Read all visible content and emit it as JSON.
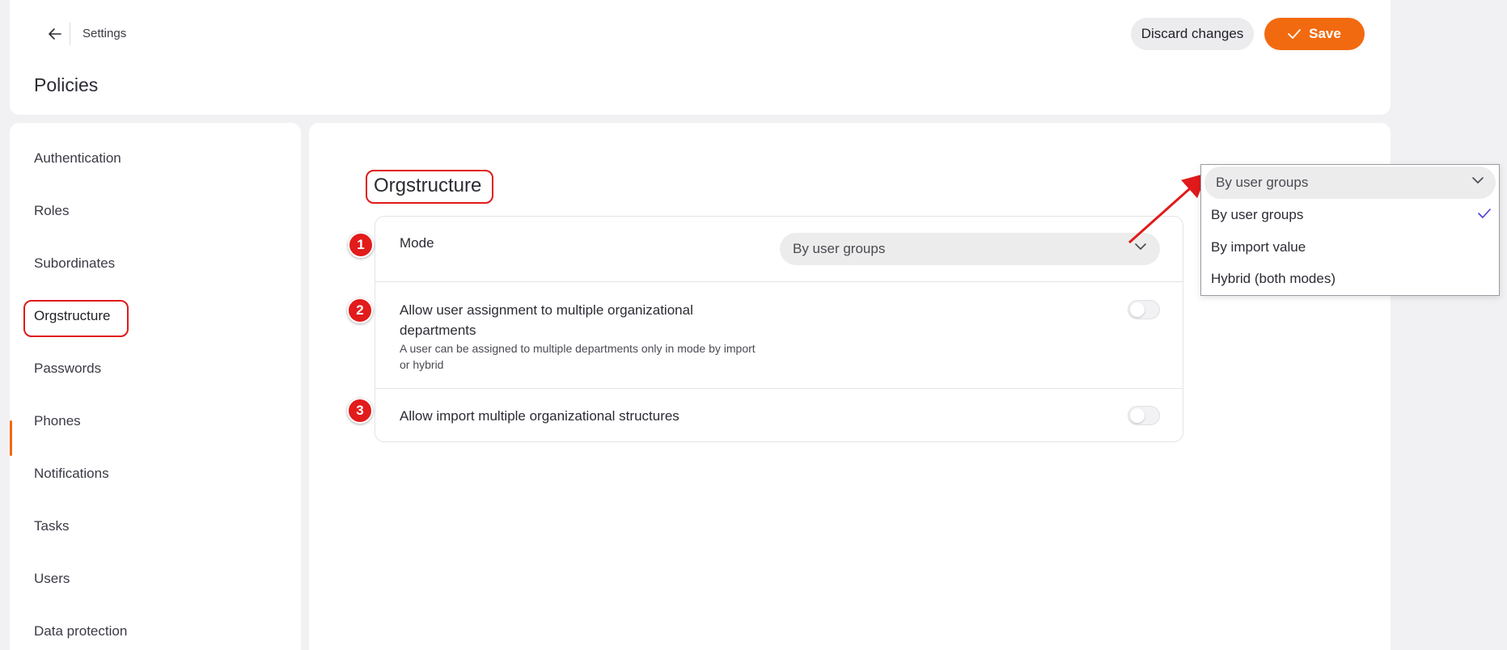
{
  "header": {
    "breadcrumb": "Settings",
    "title": "Policies",
    "discard_label": "Discard changes",
    "save_label": "Save"
  },
  "sidebar": {
    "items": [
      {
        "label": "Authentication"
      },
      {
        "label": "Roles"
      },
      {
        "label": "Subordinates"
      },
      {
        "label": "Orgstructure",
        "active": true
      },
      {
        "label": "Passwords"
      },
      {
        "label": "Phones"
      },
      {
        "label": "Notifications"
      },
      {
        "label": "Tasks"
      },
      {
        "label": "Users"
      },
      {
        "label": "Data protection"
      }
    ]
  },
  "section": {
    "title": "Orgstructure",
    "rows": [
      {
        "badge": "1",
        "title": "Mode",
        "select_value": "By user groups"
      },
      {
        "badge": "2",
        "title": "Allow user assignment to multiple organizational departments",
        "description": "A user can be assigned to multiple departments only in mode by import or hybrid",
        "enabled": false
      },
      {
        "badge": "3",
        "title": "Allow import multiple organizational structures",
        "enabled": false
      }
    ]
  },
  "dropdown": {
    "selected": "By user groups",
    "options": [
      {
        "label": "By user groups",
        "checked": true
      },
      {
        "label": "By import value",
        "checked": false
      },
      {
        "label": "Hybrid (both modes)",
        "checked": false
      }
    ]
  },
  "colors": {
    "accent": "#f26a10",
    "annotation": "#e01a1a",
    "check": "#4a3fd6"
  },
  "icons": [
    "arrow-left-icon",
    "check-icon",
    "chevron-down-icon"
  ]
}
